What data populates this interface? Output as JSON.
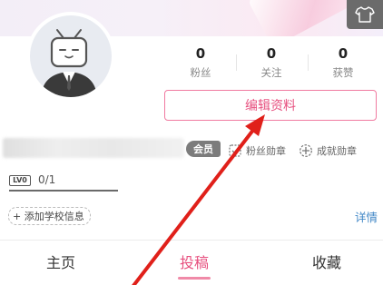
{
  "stats": [
    {
      "count": "0",
      "label": "粉丝"
    },
    {
      "count": "0",
      "label": "关注"
    },
    {
      "count": "0",
      "label": "获赞"
    }
  ],
  "edit_profile_label": "编辑资料",
  "vip_label": "会员",
  "medals": {
    "fan_medal_label": "粉丝勋章",
    "achievement_medal_label": "成就勋章"
  },
  "level": {
    "badge": "LV0",
    "progress_text": "0/1"
  },
  "school_button_label": "+ 添加学校信息",
  "detail_link_label": "详情",
  "tabs": [
    {
      "label": "主页"
    },
    {
      "label": "投稿",
      "active": true
    },
    {
      "label": "收藏"
    }
  ],
  "colors": {
    "accent_pink": "#e7507f",
    "arrow_red": "#e0201a",
    "link_blue": "#3f86c6"
  },
  "icons": [
    "shirt-icon",
    "tv-mascot-avatar",
    "fan-medal-icon",
    "achievement-medal-icon",
    "red-arrow-annotation"
  ]
}
